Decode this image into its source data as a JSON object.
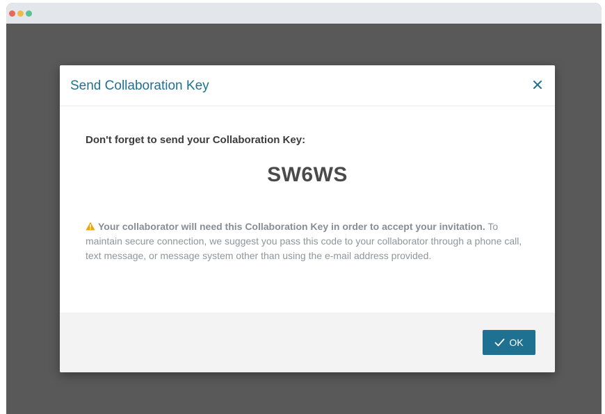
{
  "window": {
    "dots": [
      {
        "name": "close",
        "color": "#e8685a"
      },
      {
        "name": "minimize",
        "color": "#f1b84a"
      },
      {
        "name": "zoom",
        "color": "#5cc197"
      }
    ]
  },
  "dialog": {
    "title": "Send Collaboration Key",
    "close_icon": "close-icon",
    "prompt": "Don't forget to send your Collaboration Key:",
    "key": "SW6WS",
    "notice": {
      "icon": "warning-icon",
      "icon_color": "#f0a30a",
      "strong": "Your collaborator will need this Collaboration Key in order to accept your invitation.",
      "rest": " To maintain secure connection, we suggest you pass this code to your collaborator through a phone call, text message, or message system other than using the e-mail address provided."
    },
    "ok_label": "OK",
    "ok_icon": "check-icon"
  },
  "colors": {
    "accent": "#1e7190",
    "overlay": "#595959"
  }
}
